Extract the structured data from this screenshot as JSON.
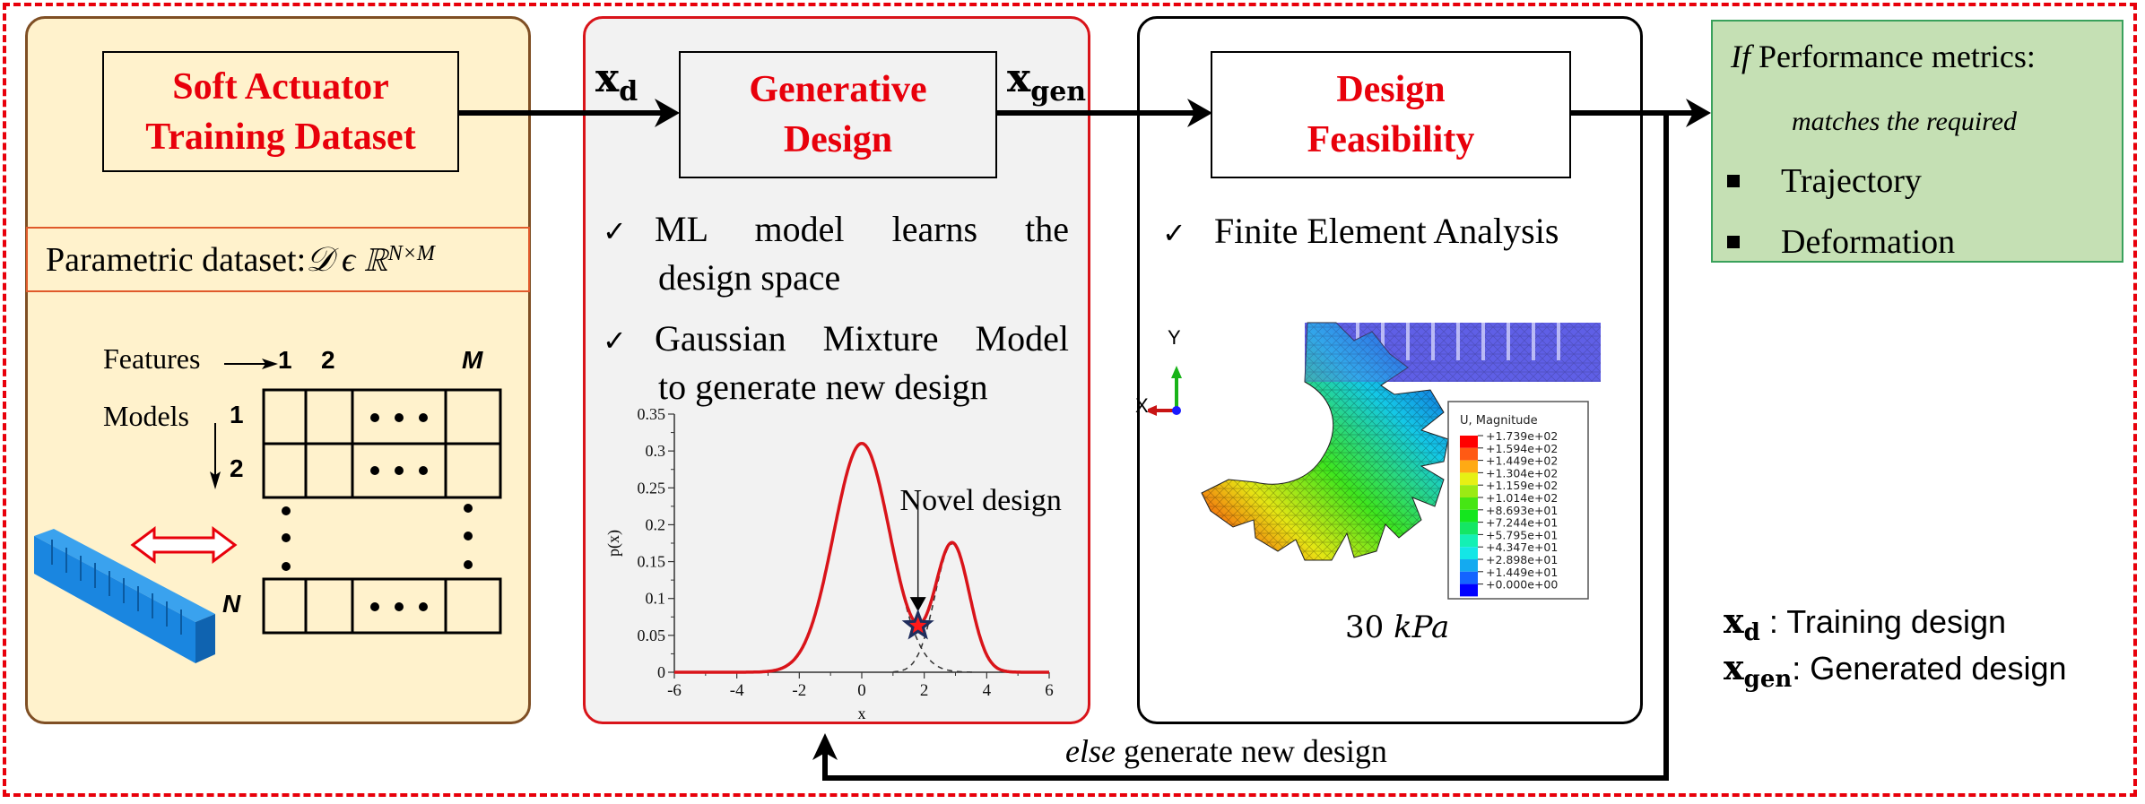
{
  "panels": {
    "dataset": {
      "title_line1": "Soft Actuator",
      "title_line2": "Training Dataset",
      "parametric_label": "Parametric dataset: ",
      "parametric_math": "𝒟 ϵ ℝ",
      "parametric_sup": "N×M",
      "features_label": "Features",
      "models_label": "Models",
      "column_labels": [
        "1",
        "2",
        "M"
      ],
      "row_labels": [
        "1",
        "2",
        "N"
      ],
      "ellipsis": "• • •",
      "actuator_color": "#1E88E5"
    },
    "generative": {
      "title_line1": "Generative",
      "title_line2": "Design",
      "bullets": [
        {
          "line1": "ML model learns the",
          "line2": "design space"
        },
        {
          "line1": "Gaussian Mixture Model",
          "line2": "to generate new design"
        }
      ]
    },
    "feasibility": {
      "title_line1": "Design",
      "title_line2": "Feasibility",
      "bullet": "Finite Element Analysis",
      "axis_y": "Y",
      "axis_x": "X",
      "legend_title": "U, Magnitude",
      "legend_values": [
        "+1.739e+02",
        "+1.594e+02",
        "+1.449e+02",
        "+1.304e+02",
        "+1.159e+02",
        "+1.014e+02",
        "+8.693e+01",
        "+7.244e+01",
        "+5.795e+01",
        "+4.347e+01",
        "+2.898e+01",
        "+1.449e+01",
        "+0.000e+00"
      ],
      "legend_colors": [
        "#ff0000",
        "#ff5a14",
        "#ffaa14",
        "#e6f014",
        "#9bea14",
        "#46e614",
        "#14e61e",
        "#14e664",
        "#14f0b4",
        "#14e6e6",
        "#14aaf0",
        "#1464ff",
        "#0000ff"
      ],
      "caption_number": "30 ",
      "caption_unit": "kPa"
    },
    "performance": {
      "if_word": "If",
      "line1": " Performance metrics:",
      "line2": "matches the required",
      "items": [
        "Trajectory",
        "Deformation"
      ]
    }
  },
  "flow": {
    "xd_label": "x",
    "xd_sub": "d",
    "xgen_label": "x",
    "xgen_sub": "gen",
    "else_word": "else",
    "else_text": " generate new design"
  },
  "legend": {
    "xd_desc": " : Training design",
    "xgen_desc": ": Generated design"
  },
  "colors": {
    "accent_red": "#e8000b",
    "curve_red": "#d9141a",
    "dataset_bg": "#FFF2CC",
    "generative_bg": "#F2F2F2",
    "performance_bg": "#C5E0B4"
  },
  "chart_data": {
    "type": "line",
    "title": "",
    "xlabel": "x",
    "ylabel": "p(x)",
    "xlim": [
      -6,
      6
    ],
    "ylim": [
      0,
      0.35
    ],
    "xticks": [
      "-6",
      "-4",
      "-2",
      "0",
      "2",
      "4",
      "6"
    ],
    "yticks": [
      "0",
      "0.05",
      "0.1",
      "0.15",
      "0.2",
      "0.25",
      "0.3",
      "0.35"
    ],
    "series": [
      {
        "name": "GMM density",
        "style": "solid",
        "components": [
          {
            "mean": 0,
            "std": 0.9,
            "weight": 0.7
          },
          {
            "mean": 2.9,
            "std": 0.55,
            "weight": 0.24
          }
        ]
      },
      {
        "name": "Component 1",
        "style": "dashed",
        "mean": 0,
        "std": 0.9,
        "weight": 0.7,
        "visible_range": [
          1.2,
          3.6
        ]
      },
      {
        "name": "Component 2",
        "style": "dashed",
        "mean": 2.9,
        "std": 0.55,
        "weight": 0.24,
        "visible_range": [
          1.0,
          2.9
        ]
      }
    ],
    "annotation": {
      "text": "Novel design",
      "x": 1.8,
      "y": 0.063,
      "marker": "star"
    }
  }
}
